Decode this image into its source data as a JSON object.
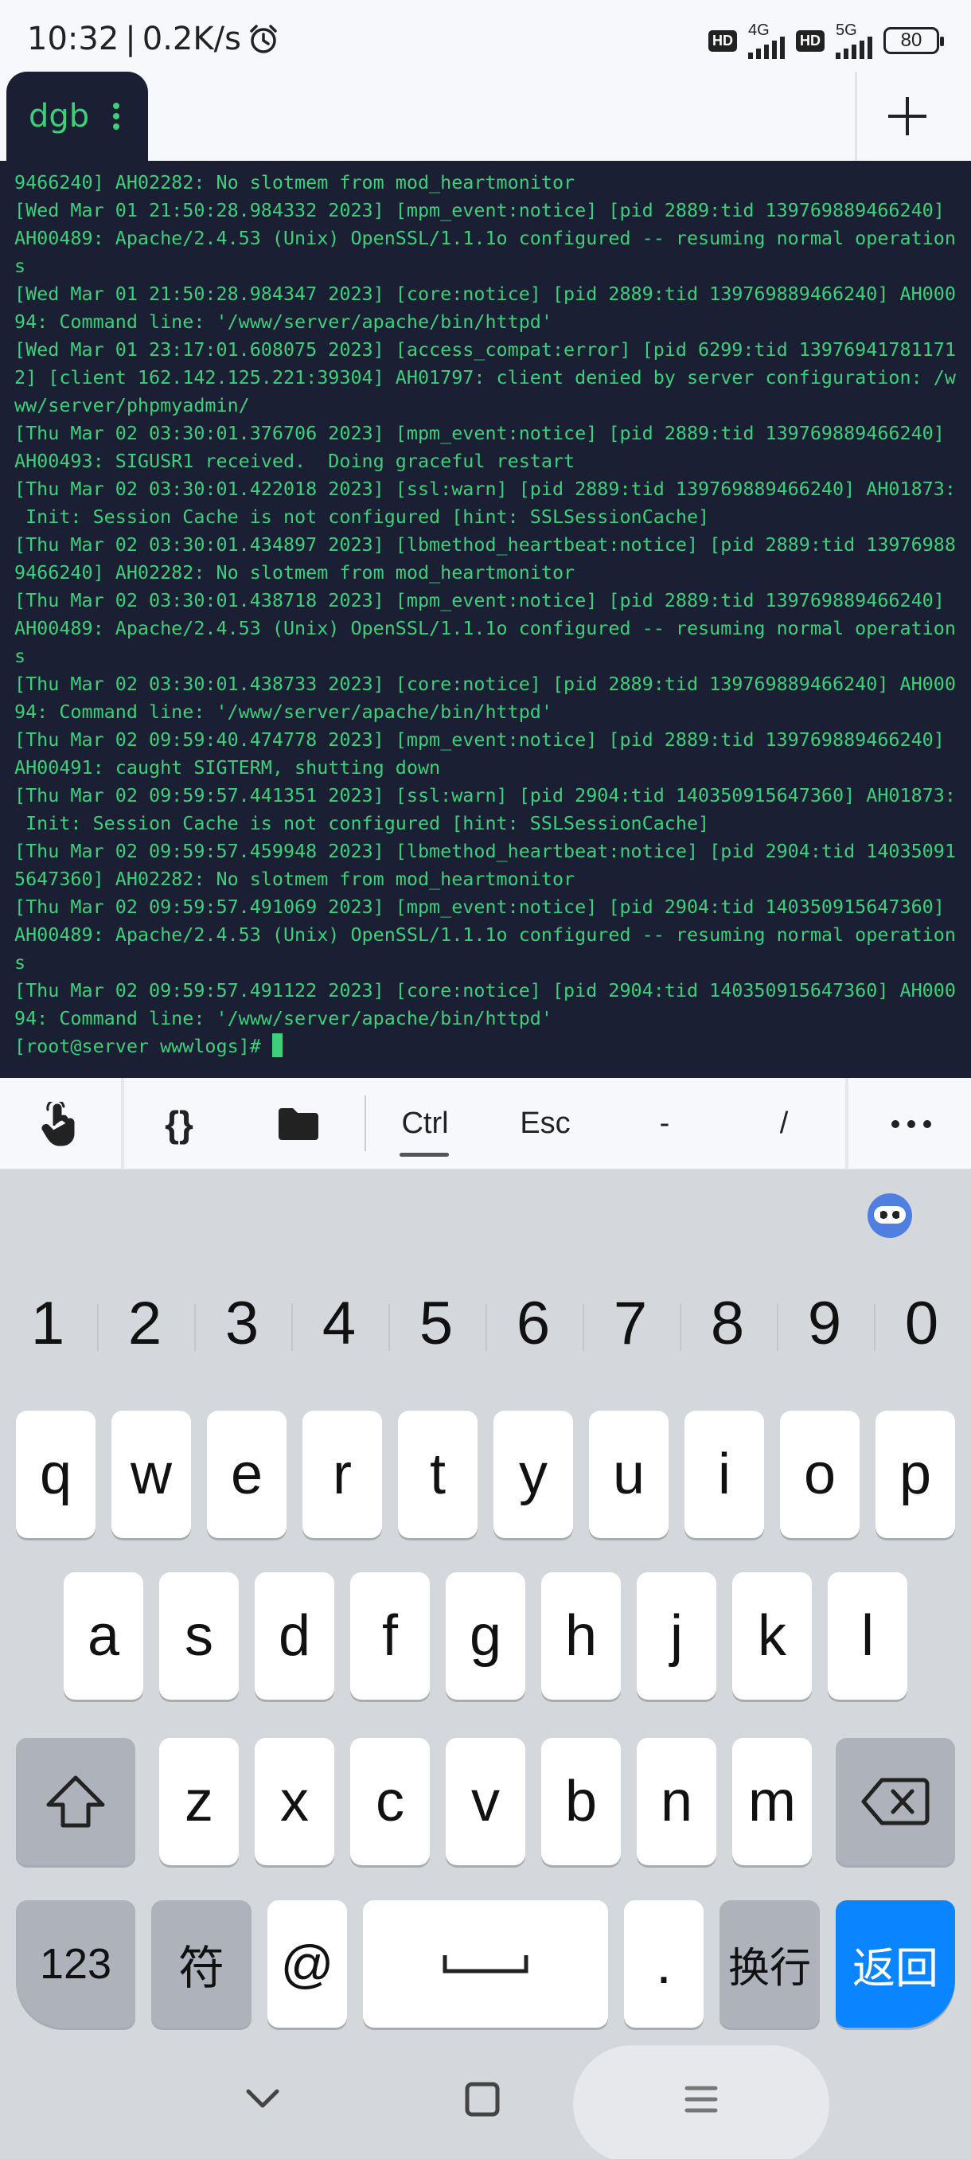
{
  "status_bar": {
    "time": "10:32",
    "separator": "|",
    "net_speed": "0.2K/s",
    "alarm_icon": "alarm-clock-icon",
    "hd1": "HD",
    "net1": "4G",
    "hd2": "HD",
    "net2": "5G",
    "battery": "80"
  },
  "tabs": {
    "active_label": "dgb",
    "menu_icon": "vertical-dots-icon",
    "add_icon": "plus-icon"
  },
  "terminal": {
    "lines": [
      "9466240] AH02282: No slotmem from mod_heartmonitor",
      "[Wed Mar 01 21:50:28.984332 2023] [mpm_event:notice] [pid 2889:tid 139769889466240]",
      "AH00489: Apache/2.4.53 (Unix) OpenSSL/1.1.1o configured -- resuming normal operation",
      "s",
      "[Wed Mar 01 21:50:28.984347 2023] [core:notice] [pid 2889:tid 139769889466240] AH000",
      "94: Command line: '/www/server/apache/bin/httpd'",
      "[Wed Mar 01 23:17:01.608075 2023] [access_compat:error] [pid 6299:tid 1397694178117​1",
      "2] [client 162.142.125.221:39304] AH01797: client denied by server configuration: /w",
      "ww/server/phpmyadmin/",
      "[Thu Mar 02 03:30:01.376706 2023] [mpm_event:notice] [pid 2889:tid 139769889466240]",
      "AH00493: SIGUSR1 received.  Doing graceful restart",
      "[Thu Mar 02 03:30:01.422018 2023] [ssl:warn] [pid 2889:tid 139769889466240] AH01873:",
      " Init: Session Cache is not configured [hint: SSLSessionCache]",
      "[Thu Mar 02 03:30:01.434897 2023] [lbmethod_heartbeat:notice] [pid 2889:tid 13976988",
      "9466240] AH02282: No slotmem from mod_heartmonitor",
      "[Thu Mar 02 03:30:01.438718 2023] [mpm_event:notice] [pid 2889:tid 139769889466240]",
      "AH00489: Apache/2.4.53 (Unix) OpenSSL/1.1.1o configured -- resuming normal operation",
      "s",
      "[Thu Mar 02 03:30:01.438733 2023] [core:notice] [pid 2889:tid 139769889466240] AH000",
      "94: Command line: '/www/server/apache/bin/httpd'",
      "[Thu Mar 02 09:59:40.474778 2023] [mpm_event:notice] [pid 2889:tid 139769889466240]",
      "AH00491: caught SIGTERM, shutting down",
      "[Thu Mar 02 09:59:57.441351 2023] [ssl:warn] [pid 2904:tid 140350915647360] AH01873:",
      " Init: Session Cache is not configured [hint: SSLSessionCache]",
      "[Thu Mar 02 09:59:57.459948 2023] [lbmethod_heartbeat:notice] [pid 2904:tid 14035091",
      "5647360] AH02282: No slotmem from mod_heartmonitor",
      "[Thu Mar 02 09:59:57.491069 2023] [mpm_event:notice] [pid 2904:tid 140350915647360]",
      "AH00489: Apache/2.4.53 (Unix) OpenSSL/1.1.1o configured -- resuming normal operation",
      "s",
      "[Thu Mar 02 09:59:57.491122 2023] [core:notice] [pid 2904:tid 140350915647360] AH000",
      "94: Command line: '/www/server/apache/bin/httpd'"
    ],
    "prompt": "[root@server wwwlogs]# "
  },
  "toolbar": {
    "touch_icon": "touch-hand-icon",
    "braces": "{}",
    "folder_icon": "folder-icon",
    "ctrl": "Ctrl",
    "esc": "Esc",
    "dash": "-",
    "slash": "/",
    "more_icon": "more-dots-icon"
  },
  "keyboard": {
    "logo_icon": "keyboard-logo-icon",
    "numbers": [
      "1",
      "2",
      "3",
      "4",
      "5",
      "6",
      "7",
      "8",
      "9",
      "0"
    ],
    "row1": [
      "q",
      "w",
      "e",
      "r",
      "t",
      "y",
      "u",
      "i",
      "o",
      "p"
    ],
    "row2": [
      "a",
      "s",
      "d",
      "f",
      "g",
      "h",
      "j",
      "k",
      "l"
    ],
    "row3": [
      "z",
      "x",
      "c",
      "v",
      "b",
      "n",
      "m"
    ],
    "shift_icon": "shift-arrow-icon",
    "backspace_icon": "backspace-icon",
    "num_mode": "123",
    "symbol_mode": "符",
    "at": "@",
    "space_icon": "space-bar-icon",
    "dot": ".",
    "newline": "换行",
    "return": "返回",
    "nav_back_icon": "chevron-down-icon",
    "nav_home_icon": "square-home-icon",
    "nav_menu_icon": "menu-lines-icon"
  },
  "colors": {
    "terminal_bg": "#1a1f33",
    "terminal_fg": "#3ecf7a",
    "return_key": "#0a84ff"
  }
}
